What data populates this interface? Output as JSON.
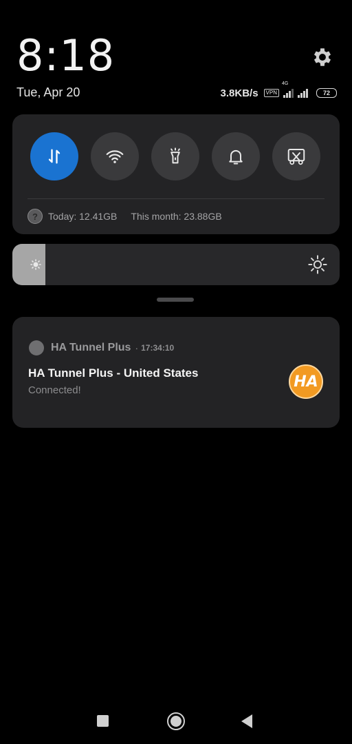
{
  "status": {
    "time": "8:18",
    "date": "Tue, Apr 20",
    "net_speed": "3.8KB/s",
    "vpn_badge": "VPN",
    "network_type": "4G",
    "battery": "72"
  },
  "quick_settings": {
    "tiles": [
      {
        "name": "mobile-data",
        "icon": "data-arrows-icon",
        "active": true
      },
      {
        "name": "wifi",
        "icon": "wifi-icon",
        "active": false
      },
      {
        "name": "flashlight",
        "icon": "flashlight-icon",
        "active": false
      },
      {
        "name": "sound",
        "icon": "bell-icon",
        "active": false
      },
      {
        "name": "screenshot",
        "icon": "scissors-screenshot-icon",
        "active": false
      }
    ],
    "usage_today": "Today: 12.41GB",
    "usage_month": "This month: 23.88GB"
  },
  "brightness": {
    "level_fraction": 0.1
  },
  "notification": {
    "app_name": "HA Tunnel Plus",
    "separator": "·",
    "time": "17:34:10",
    "title": "HA Tunnel Plus - United States",
    "text": "Connected!",
    "logo_text": "HA"
  },
  "colors": {
    "accent": "#1a73d1",
    "logo": "#f29a22"
  }
}
